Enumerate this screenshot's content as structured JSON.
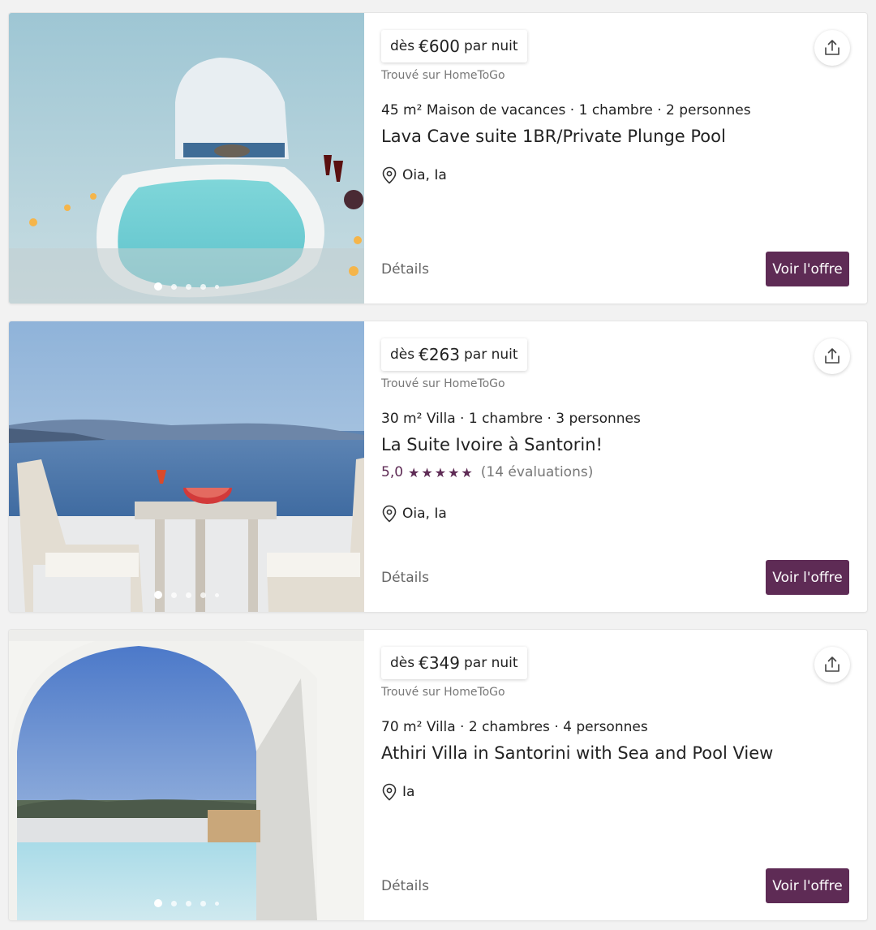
{
  "listings": [
    {
      "price_prefix": "dès",
      "price_amount": "€600",
      "price_suffix": "par nuit",
      "found_on": "Trouvé sur HomeToGo",
      "facts": "45 m² Maison de vacances · 1 chambre · 2 personnes",
      "title": "Lava Cave suite 1BR/Private Plunge Pool",
      "location": "Oia, Ia",
      "details_label": "Détails",
      "offer_label": "Voir l'offre"
    },
    {
      "price_prefix": "dès",
      "price_amount": "€263",
      "price_suffix": "par nuit",
      "found_on": "Trouvé sur HomeToGo",
      "facts": "30 m² Villa · 1 chambre · 3 personnes",
      "title": "La Suite Ivoire à Santorin!",
      "rating_score": "5,0",
      "rating_stars": "★★★★★",
      "rating_count": "(14 évaluations)",
      "location": "Oia, Ia",
      "details_label": "Détails",
      "offer_label": "Voir l'offre"
    },
    {
      "price_prefix": "dès",
      "price_amount": "€349",
      "price_suffix": "par nuit",
      "found_on": "Trouvé sur HomeToGo",
      "facts": "70 m² Villa · 2 chambres · 4 personnes",
      "title": "Athiri Villa in Santorini with Sea and Pool View",
      "location": "Ia",
      "details_label": "Détails",
      "offer_label": "Voir l'offre"
    }
  ],
  "icons": {
    "share": "share-icon",
    "location": "location-pin-icon"
  },
  "colors": {
    "accent": "#5e2b55",
    "muted_text": "#777777"
  }
}
